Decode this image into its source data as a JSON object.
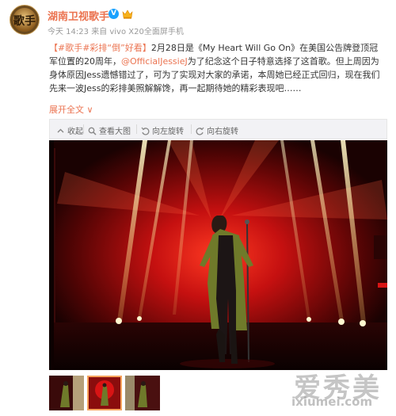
{
  "author": {
    "name": "湖南卫视歌手",
    "verified_badge": "V",
    "avatar_text": "歌手",
    "avatar_color": "#6b4a1e"
  },
  "meta": {
    "time": "今天 14:23",
    "source": "来自 vivo X20全面屏手机"
  },
  "content": {
    "hashtags": "【#歌手#彩排“倒”好看】",
    "part1": "2月28日是《My Heart Will Go On》在美国公告牌登顶冠军位置的20周年，",
    "mention": "@OfficialJessieJ",
    "part2": "为了纪念这个日子特意选择了这首歌。但上周因为身体原因Jess遗憾错过了，可为了实现对大家的承诺，本周她已经正式回归，现在我们先来一波Jess的彩排美照解解馋，再一起期待她的精彩表现吧……"
  },
  "expand_label": "展开全文 ∨",
  "toolbar": {
    "collapse": "收起",
    "view_large": "查看大图",
    "rotate_left": "向左旋转",
    "rotate_right": "向右旋转"
  },
  "watermark": {
    "main": "爱秀美",
    "sub": "ixiumei.com"
  },
  "colors": {
    "accent": "#eb7350",
    "verified": "#1aa2ff",
    "stage_red": "#d81414",
    "coat_green": "#6f7a2a"
  },
  "thumbnails": {
    "count": 3,
    "selected_index": 1
  }
}
